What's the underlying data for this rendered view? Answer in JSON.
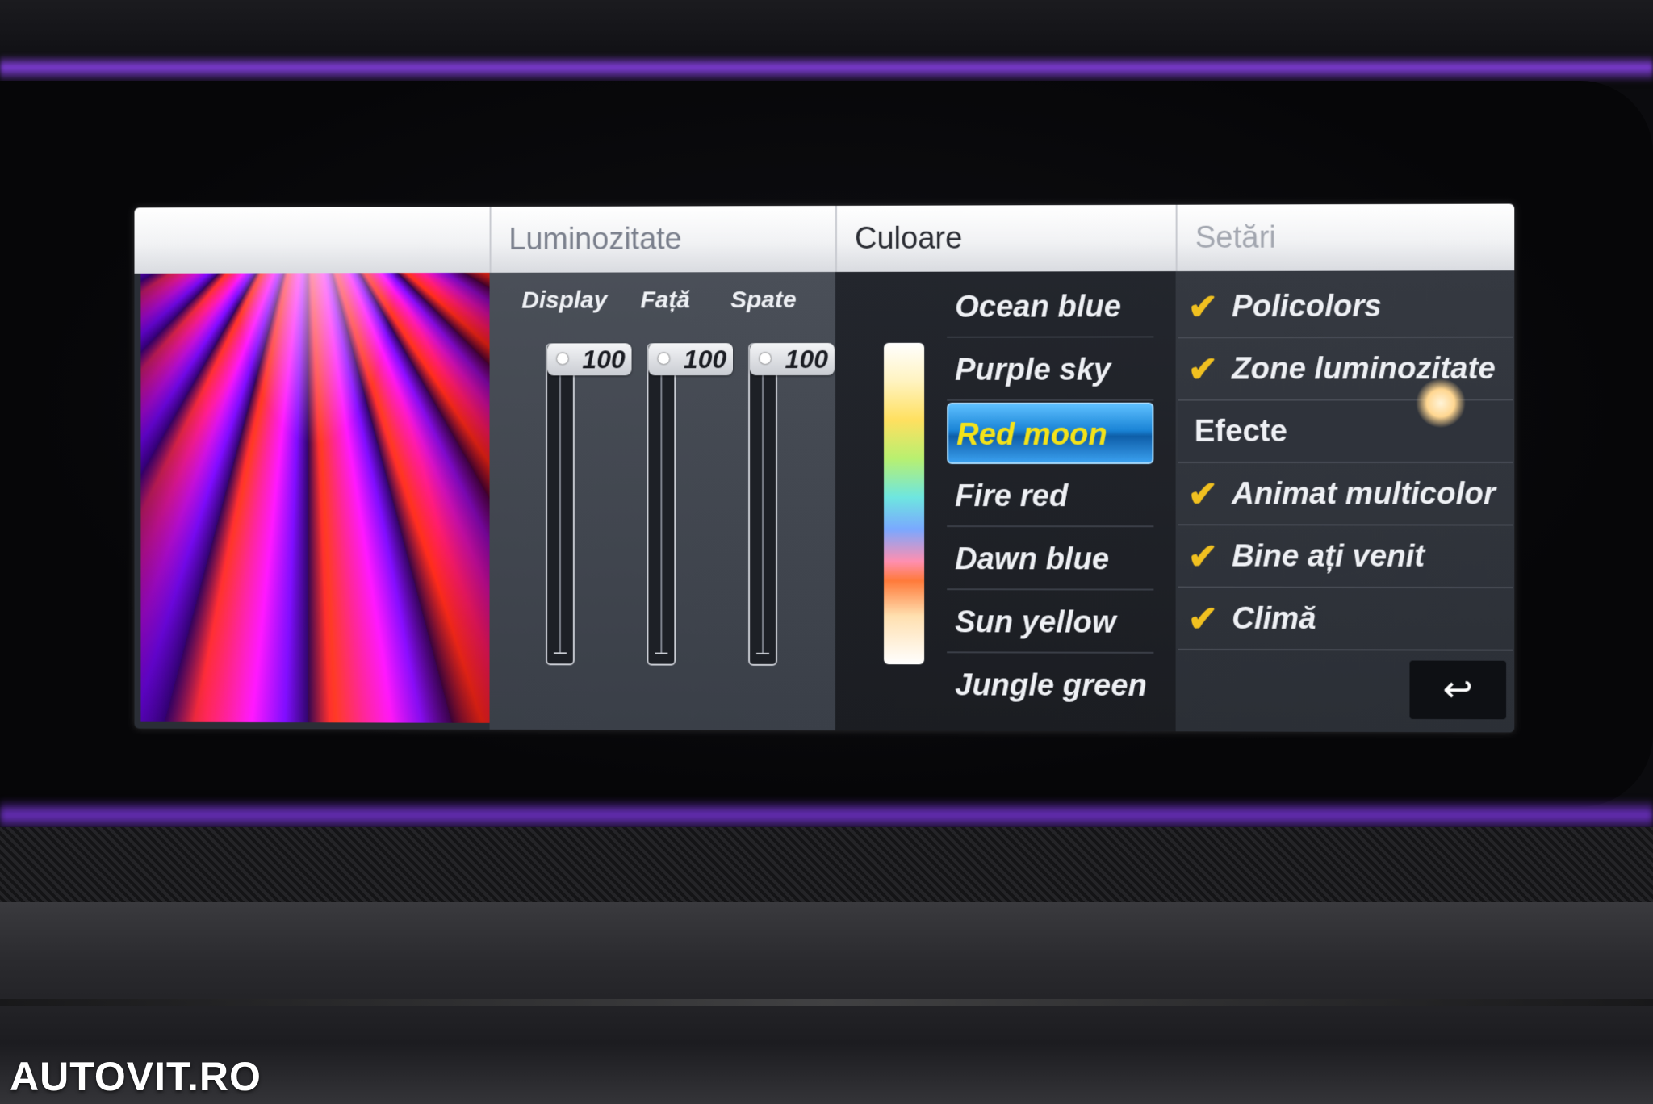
{
  "tabs": [
    {
      "label": ""
    },
    {
      "label": "Luminozitate"
    },
    {
      "label": "Culoare"
    },
    {
      "label": "Setări"
    }
  ],
  "brightness": {
    "sliders": [
      {
        "label": "Display",
        "value": "100"
      },
      {
        "label": "Față",
        "value": "100"
      },
      {
        "label": "Spate",
        "value": "100"
      }
    ]
  },
  "color": {
    "items": [
      {
        "label": "Ocean blue"
      },
      {
        "label": "Purple sky"
      },
      {
        "label": "Red moon"
      },
      {
        "label": "Fire red"
      },
      {
        "label": "Dawn blue"
      },
      {
        "label": "Sun yellow"
      },
      {
        "label": "Jungle green"
      }
    ],
    "selected": "Red moon",
    "selected_color": "#f3e21a",
    "highlight_color": "#1a84d6"
  },
  "settings": {
    "items": [
      {
        "label": "Policolors",
        "checked": true
      },
      {
        "label": "Zone luminozitate",
        "checked": true
      },
      {
        "label": "Efecte",
        "header": true
      },
      {
        "label": "Animat multicolor",
        "checked": true
      },
      {
        "label": "Bine ați venit",
        "checked": true
      },
      {
        "label": "Climă",
        "checked": true
      }
    ],
    "check_icon": "checkmark-icon",
    "check_color": "#f0c020",
    "back_icon": "back-arrow-icon"
  },
  "watermark": "AUTOVIT.RO"
}
